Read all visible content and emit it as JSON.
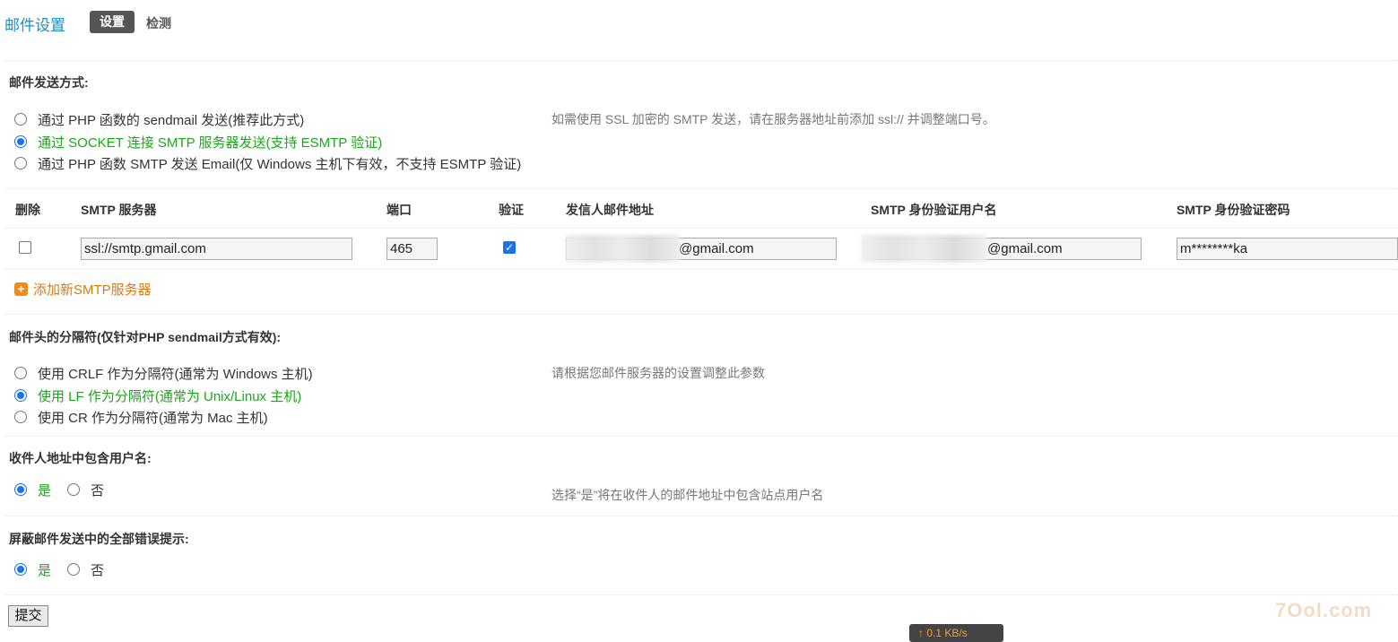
{
  "header": {
    "title": "邮件设置",
    "tabs": [
      "设置",
      "检测"
    ]
  },
  "send_method": {
    "title": "邮件发送方式:",
    "options": [
      "通过 PHP 函数的 sendmail 发送(推荐此方式)",
      "通过 SOCKET 连接 SMTP 服务器发送(支持 ESMTP 验证)",
      "通过 PHP 函数 SMTP 发送 Email(仅 Windows 主机下有效，不支持 ESMTP 验证)"
    ],
    "selected_index": 1,
    "tip": "如需使用 SSL 加密的 SMTP 发送，请在服务器地址前添加 ssl:// 并调整端口号。"
  },
  "smtp_table": {
    "headers": [
      "删除",
      "SMTP 服务器",
      "端口",
      "验证",
      "发信人邮件地址",
      "SMTP 身份验证用户名",
      "SMTP 身份验证密码"
    ],
    "row": {
      "delete_checked": false,
      "server": "ssl://smtp.gmail.com",
      "port": "465",
      "auth_checked": true,
      "sender_suffix": "@gmail.com",
      "username_suffix": "@gmail.com",
      "password": "m********ka"
    },
    "add_label": "添加新SMTP服务器"
  },
  "separator": {
    "title": "邮件头的分隔符(仅针对PHP sendmail方式有效):",
    "options": [
      "使用 CRLF 作为分隔符(通常为 Windows 主机)",
      "使用 LF 作为分隔符(通常为 Unix/Linux 主机)",
      "使用 CR 作为分隔符(通常为 Mac 主机)"
    ],
    "selected_index": 1,
    "tip": "请根据您邮件服务器的设置调整此参数"
  },
  "include_username": {
    "title": "收件人地址中包含用户名:",
    "yes": "是",
    "no": "否",
    "tip": "选择“是”将在收件人的邮件地址中包含站点用户名"
  },
  "silent": {
    "title": "屏蔽邮件发送中的全部错误提示:",
    "yes": "是",
    "no": "否"
  },
  "submit_label": "提交",
  "watermark": "7Ool.com",
  "speed_label": "↑ 0.1 KB/s",
  "colors": {
    "title_blue": "#1d8fc4",
    "green": "#1aa81a",
    "orange": "#e07a0c",
    "accent": "#1a73e8"
  }
}
